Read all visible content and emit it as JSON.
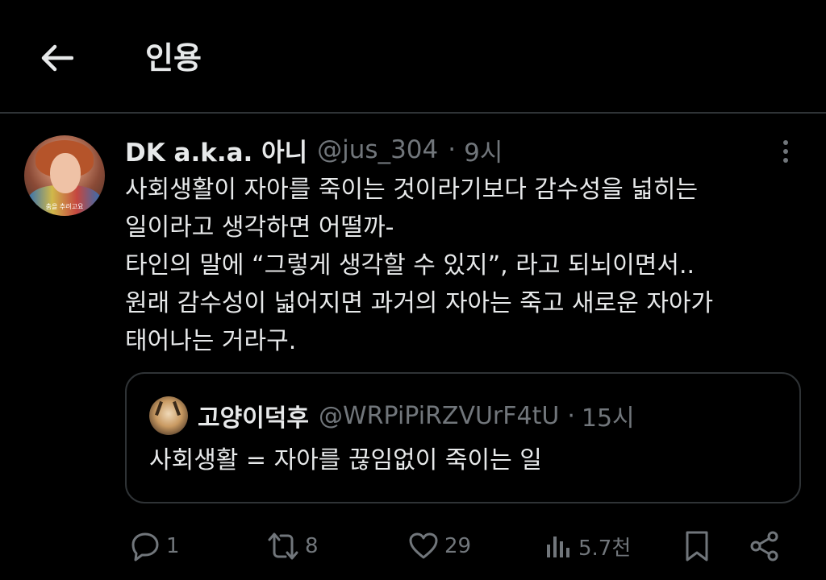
{
  "header": {
    "title": "인용"
  },
  "tweet": {
    "author_name": "DK a.k.a. 아니",
    "author_handle": "@jus_304",
    "separator": "·",
    "time": "9시",
    "avatar_caption": "춤을 추려고요",
    "lines": [
      "사회생활이 자아를 죽이는 것이라기보다 감수성을 넓히는",
      "일이라고 생각하면 어떨까-",
      "타인의 말에 “그렇게 생각할 수 있지”, 라고 되뇌이면서..",
      "원래 감수성이 넓어지면 과거의 자아는 죽고 새로운 자아가",
      "태어나는 거라구."
    ]
  },
  "quote": {
    "author_name": "고양이덕후",
    "author_handle": "@WRPiPiRZVUrF4tU",
    "separator": "·",
    "time": "15시",
    "text": "사회생활 = 자아를 끊임없이 죽이는 일"
  },
  "actions": {
    "reply_count": "1",
    "retweet_count": "8",
    "like_count": "29",
    "view_count": "5.7천"
  },
  "colors": {
    "background": "#000000",
    "text_primary": "#e7e9ea",
    "text_secondary": "#71767b",
    "border": "#2f3336"
  }
}
